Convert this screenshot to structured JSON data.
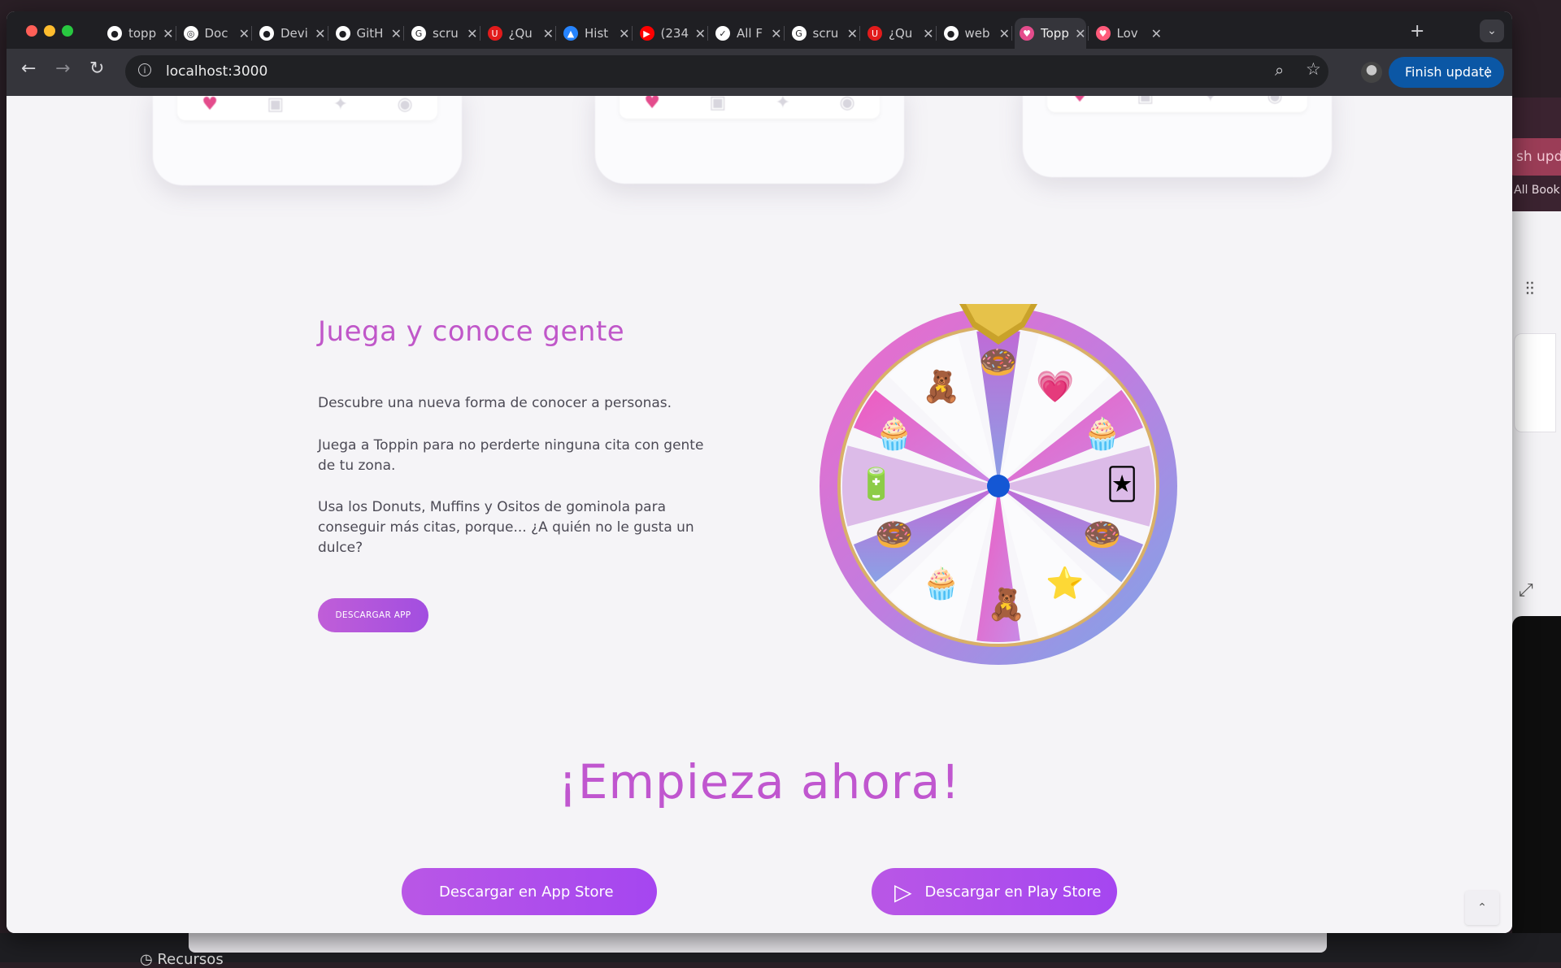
{
  "browser": {
    "tabs": [
      {
        "title": "topp",
        "icon": "github-icon",
        "color": "#ffffff"
      },
      {
        "title": "Doc",
        "icon": "docs-icon",
        "color": "#ffffff"
      },
      {
        "title": "Devi",
        "icon": "github-icon",
        "color": "#ffffff"
      },
      {
        "title": "GitH",
        "icon": "github-icon",
        "color": "#ffffff"
      },
      {
        "title": "scru",
        "icon": "google-icon",
        "color": "#ffffff"
      },
      {
        "title": "¿Qu",
        "icon": "u-logo-icon",
        "color": "#e21b1b"
      },
      {
        "title": "Hist",
        "icon": "atlassian-icon",
        "color": "#2684ff"
      },
      {
        "title": "(234",
        "icon": "youtube-icon",
        "color": "#ff0000"
      },
      {
        "title": "All F",
        "icon": "tasks-icon",
        "color": "#ffffff"
      },
      {
        "title": "scru",
        "icon": "google-icon",
        "color": "#ffffff"
      },
      {
        "title": "¿Qu",
        "icon": "u-logo-icon",
        "color": "#e21b1b"
      },
      {
        "title": "web",
        "icon": "github-icon",
        "color": "#ffffff"
      },
      {
        "title": "Topp",
        "icon": "toppin-heart-icon",
        "color": "#e44c8c"
      },
      {
        "title": "Lov",
        "icon": "lovable-icon",
        "color": "#ff5a7a"
      }
    ],
    "url": "localhost:3000",
    "finish_update": "Finish update"
  },
  "section": {
    "title": "Juega y conoce gente",
    "p1": "Descubre una nueva forma de conocer a personas.",
    "p2": "Juega a Toppin para no perderte ninguna cita con gente de tu zona.",
    "p3": "Usa los Donuts, Muffins y Ositos de gominola para conseguir más citas, porque... ¿A quién no le gusta un dulce?",
    "button": "DESCARGAR APP"
  },
  "cta": {
    "heading": "¡Empieza ahora!",
    "app_store": "Descargar en App Store",
    "play_store": "Descargar en Play Store"
  },
  "background": {
    "pill": "sh upda",
    "text": "All Book",
    "bottom": "Recursos"
  },
  "colors": {
    "accent": "#c057c9",
    "button": "#a546f0",
    "chrome_blue": "#0b57a5"
  }
}
